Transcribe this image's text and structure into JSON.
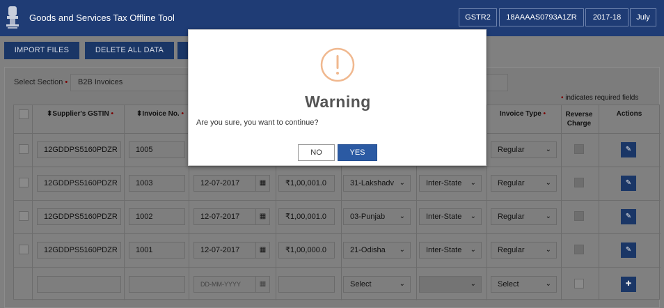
{
  "header": {
    "title": "Goods and Services Tax Offline Tool",
    "return_type": "GSTR2",
    "gstin": "18AAAAS0793A1ZR",
    "fiscal_year": "2017-18",
    "month": "July"
  },
  "toolbar": {
    "import_files": "IMPORT FILES",
    "delete_all_data": "DELETE ALL DATA"
  },
  "section": {
    "label": "Select Section",
    "value": "B2B Invoices",
    "required_note": "indicates required fields"
  },
  "table": {
    "headers": {
      "supplier_gstin": "⬍Supplier's GSTIN",
      "invoice_no": "⬍Invoice No.",
      "invoice_type": "Invoice Type",
      "reverse_charge": "Reverse Charge",
      "actions": "Actions"
    },
    "rows": [
      {
        "gstin": "12GDDPS5160PDZR",
        "invoice_no": "1005",
        "date": "",
        "value": "",
        "place": "",
        "supply_type": "",
        "invoice_type": "Regular"
      },
      {
        "gstin": "12GDDPS5160PDZR",
        "invoice_no": "1003",
        "date": "12-07-2017",
        "value": "₹1,00,001.0",
        "place": "31-Lakshadv",
        "supply_type": "Inter-State",
        "invoice_type": "Regular"
      },
      {
        "gstin": "12GDDPS5160PDZR",
        "invoice_no": "1002",
        "date": "12-07-2017",
        "value": "₹1,00,001.0",
        "place": "03-Punjab",
        "supply_type": "Inter-State",
        "invoice_type": "Regular"
      },
      {
        "gstin": "12GDDPS5160PDZR",
        "invoice_no": "1001",
        "date": "12-07-2017",
        "value": "₹1,00,000.0",
        "place": "21-Odisha",
        "supply_type": "Inter-State",
        "invoice_type": "Regular"
      }
    ],
    "new_row": {
      "date_placeholder": "DD-MM-YYYY",
      "place": "Select",
      "invoice_type": "Select"
    }
  },
  "modal": {
    "title": "Warning",
    "message": "Are you sure, you want to continue?",
    "no_label": "NO",
    "yes_label": "YES"
  },
  "colors": {
    "header_bg": "#1f3c75",
    "primary_button": "#2b5aa3",
    "warning_icon": "#f0b88f"
  }
}
